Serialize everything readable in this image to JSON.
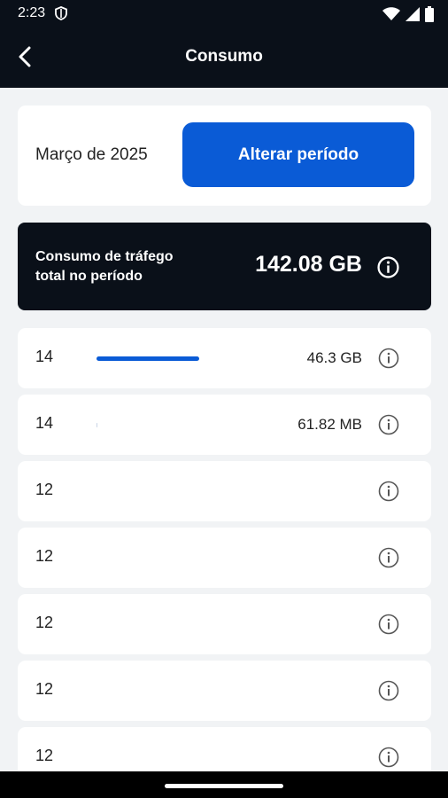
{
  "status_bar": {
    "time": "2:23"
  },
  "app_bar": {
    "title": "Consumo"
  },
  "period": {
    "label": "Março de 2025",
    "button_label": "Alterar período"
  },
  "total": {
    "label": "Consumo de tráfego total no período",
    "value": "142.08 GB"
  },
  "rows": [
    {
      "day": "14",
      "amount": "46.3 GB",
      "usage_fraction": 0.33
    },
    {
      "day": "14",
      "amount": "61.82 MB",
      "usage_fraction": 0.004
    },
    {
      "day": "12",
      "amount": "",
      "usage_fraction": 0
    },
    {
      "day": "12",
      "amount": "",
      "usage_fraction": 0
    },
    {
      "day": "12",
      "amount": "",
      "usage_fraction": 0
    },
    {
      "day": "12",
      "amount": "",
      "usage_fraction": 0
    },
    {
      "day": "12",
      "amount": "",
      "usage_fraction": 0
    }
  ],
  "colors": {
    "accent": "#0a5bd6",
    "dark": "#0a1019",
    "background": "#f1f3f5"
  }
}
